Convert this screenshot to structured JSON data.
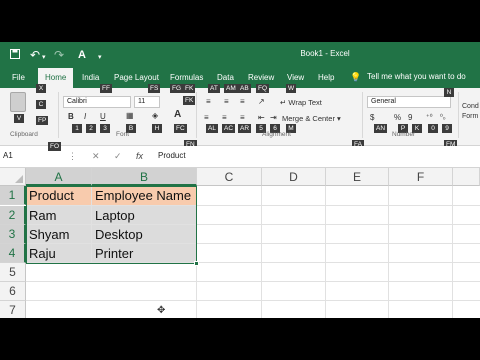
{
  "window": {
    "title": "Book1  -  Excel",
    "accent_color": "#217346",
    "qat_icons": [
      "save-icon",
      "undo-icon",
      "redo-icon",
      "font-color-icon",
      "customize-icon"
    ]
  },
  "tabs": {
    "file": "File",
    "home": "Home",
    "insert": "India",
    "page_layout": "Page Layout",
    "formulas": "Formulas",
    "data": "Data",
    "review": "Review",
    "view": "View",
    "help": "Help",
    "tell_me": "Tell me what you want to do"
  },
  "ribbon": {
    "font_name": "Calibri",
    "font_size": "11",
    "bold": "B",
    "italic": "I",
    "underline": "U",
    "wrap_text": "Wrap Text",
    "merge_center": "Merge & Center",
    "number_format": "General",
    "currency": "$",
    "percent": "%",
    "comma": "9",
    "cond_format": "Cond Form",
    "group_clipboard": "Clipboard",
    "group_font": "Font",
    "group_alignment": "Alignment",
    "group_number": "Number",
    "keytips": {
      "paste_v": "V",
      "cut_x": "X",
      "copy_c": "C",
      "format_painter": "FP",
      "font_name": "FF",
      "font_size": "FS",
      "grow": "FG",
      "shrink": "FK",
      "align_top": "AT",
      "align_middle": "AM",
      "align_bottom": "AB",
      "orientation": "FQ",
      "wrap": "W",
      "number_format": "N",
      "bold": "1",
      "italic": "2",
      "underline": "3",
      "border": "B",
      "fill": "H",
      "font_color": "FC",
      "align_left": "AL",
      "align_center": "AC",
      "align_right": "AR",
      "dec_indent": "5",
      "inc_indent": "6",
      "merge": "M",
      "accounting": "AN",
      "percent": "P",
      "comma": "K",
      "inc_dec": "0",
      "dec_dec": "9",
      "clipboard_launcher": "FO",
      "font_launcher": "FN",
      "alignment_launcher": "FA",
      "number_launcher": "FM"
    }
  },
  "formula_bar": {
    "name_box": "A1",
    "cancel": "✕",
    "enter": "✓",
    "fx": "fx",
    "value": "Product"
  },
  "grid": {
    "columns": [
      "A",
      "B",
      "C",
      "D",
      "E",
      "F"
    ],
    "rows": [
      "1",
      "2",
      "3",
      "4",
      "5",
      "6",
      "7"
    ],
    "cells": [
      [
        "Product",
        "Employee Name"
      ],
      [
        "Ram",
        "Laptop"
      ],
      [
        "Shyam",
        "Desktop"
      ],
      [
        "Raju",
        "Printer"
      ]
    ],
    "header_fill": "#f8cbad",
    "selection_fill": "#dcdcdc"
  }
}
